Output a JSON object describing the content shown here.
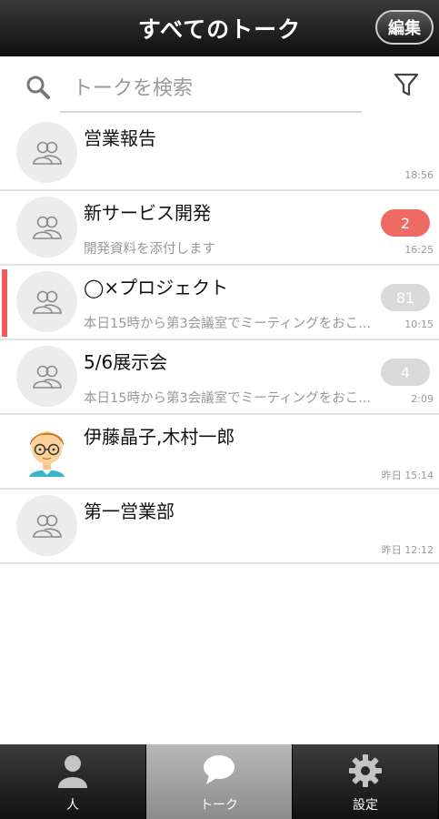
{
  "header": {
    "title": "すべてのトーク",
    "edit_label": "編集"
  },
  "search": {
    "placeholder": "トークを検索"
  },
  "talks": [
    {
      "name": "営業報告",
      "preview": "",
      "time": "18:56",
      "badge": "",
      "avatar": "group"
    },
    {
      "name": "新サービス開発",
      "preview": "開発資料を添付します",
      "time": "16:25",
      "badge": "2",
      "badge_color": "#f06a65",
      "avatar": "group"
    },
    {
      "name": "◯×プロジェクト",
      "preview": "本日15時から第3会議室でミーティングをおこ...",
      "time": "10:15",
      "badge": "81",
      "avatar": "group",
      "active": true
    },
    {
      "name": "5/6展示会",
      "preview": "本日15時から第3会議室でミーティングをおこ...",
      "time": "2:09",
      "badge": "4",
      "avatar": "group"
    },
    {
      "name": "伊藤晶子,木村一郎",
      "preview": "",
      "time": "昨日 15:14",
      "badge": "",
      "avatar": "person"
    },
    {
      "name": "第一営業部",
      "preview": "",
      "time": "昨日 12:12",
      "badge": "",
      "avatar": "group"
    }
  ],
  "tabs": [
    {
      "label": "人",
      "icon": "person-icon"
    },
    {
      "label": "トーク",
      "icon": "chat-bubble-icon",
      "selected": true
    },
    {
      "label": "設定",
      "icon": "gear-icon"
    }
  ],
  "colors": {
    "accent": "#f25a5a",
    "badge_red": "#f06a65",
    "badge_gray": "#dadada"
  }
}
